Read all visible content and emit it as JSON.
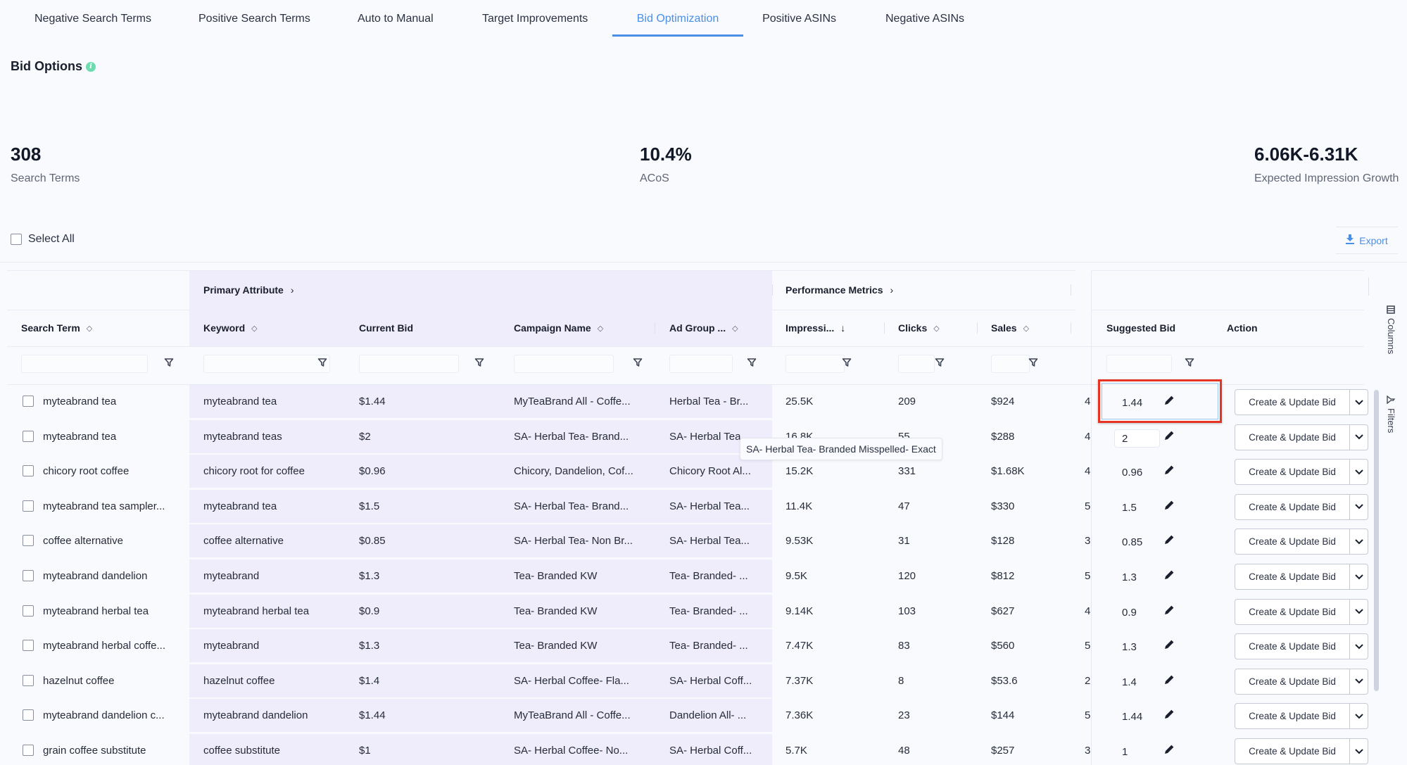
{
  "tabs": [
    {
      "label": "Negative Search Terms",
      "active": false
    },
    {
      "label": "Positive Search Terms",
      "active": false
    },
    {
      "label": "Auto to Manual",
      "active": false
    },
    {
      "label": "Target Improvements",
      "active": false
    },
    {
      "label": "Bid Optimization",
      "active": true
    },
    {
      "label": "Positive ASINs",
      "active": false
    },
    {
      "label": "Negative ASINs",
      "active": false
    }
  ],
  "section": {
    "title": "Bid Options",
    "info_icon": "info-icon"
  },
  "kpis": [
    {
      "value": "308",
      "label": "Search Terms"
    },
    {
      "value": "10.4%",
      "label": "ACoS"
    },
    {
      "value": "6.06K-6.31K",
      "label": "Expected Impression Growth"
    }
  ],
  "select_all_label": "Select All",
  "export_label": "Export",
  "colors": {
    "accent": "#4a8fe7",
    "highlight": "#e53423",
    "group_bg": "#efecfb",
    "info": "#6fdbb0"
  },
  "grid": {
    "groups": {
      "primary": "Primary Attribute",
      "performance": "Performance Metrics"
    },
    "columns": {
      "search_term": "Search Term",
      "keyword": "Keyword",
      "current_bid": "Current Bid",
      "campaign": "Campaign Name",
      "ad_group": "Ad Group ...",
      "impressions": "Impressi...",
      "clicks": "Clicks",
      "sales": "Sales",
      "suggested_bid": "Suggested Bid",
      "action": "Action"
    },
    "sort": {
      "impressions": "descending"
    },
    "action_label": "Create & Update Bid",
    "rows": [
      {
        "search_term": "myteabrand tea",
        "keyword": "myteabrand tea",
        "current_bid": "$1.44",
        "campaign": "MyTeaBrand All - Coffe...",
        "ad_group": "Herbal Tea - Br...",
        "impressions": "25.5K",
        "clicks": "209",
        "sales": "$924",
        "hidden_col": "4",
        "suggested_bid": "1.44"
      },
      {
        "search_term": "myteabrand tea",
        "keyword": "myteabrand teas",
        "current_bid": "$2",
        "campaign": "SA- Herbal Tea- Brand...",
        "ad_group": "SA- Herbal Tea",
        "impressions": "16.8K",
        "clicks": "55",
        "sales": "$288",
        "hidden_col": "4",
        "suggested_bid": "2"
      },
      {
        "search_term": "chicory root coffee",
        "keyword": "chicory root for coffee",
        "current_bid": "$0.96",
        "campaign": "Chicory, Dandelion, Cof...",
        "ad_group": "Chicory Root Al...",
        "impressions": "15.2K",
        "clicks": "331",
        "sales": "$1.68K",
        "hidden_col": "4",
        "suggested_bid": "0.96"
      },
      {
        "search_term": "myteabrand tea sampler...",
        "keyword": "myteabrand tea",
        "current_bid": "$1.5",
        "campaign": "SA- Herbal Tea- Brand...",
        "ad_group": "SA- Herbal Tea...",
        "impressions": "11.4K",
        "clicks": "47",
        "sales": "$330",
        "hidden_col": "5",
        "suggested_bid": "1.5"
      },
      {
        "search_term": "coffee alternative",
        "keyword": "coffee alternative",
        "current_bid": "$0.85",
        "campaign": "SA- Herbal Tea- Non Br...",
        "ad_group": "SA- Herbal Tea...",
        "impressions": "9.53K",
        "clicks": "31",
        "sales": "$128",
        "hidden_col": "3",
        "suggested_bid": "0.85"
      },
      {
        "search_term": "myteabrand dandelion",
        "keyword": "myteabrand",
        "current_bid": "$1.3",
        "campaign": "Tea- Branded KW",
        "ad_group": "Tea- Branded- ...",
        "impressions": "9.5K",
        "clicks": "120",
        "sales": "$812",
        "hidden_col": "5",
        "suggested_bid": "1.3"
      },
      {
        "search_term": "myteabrand herbal tea",
        "keyword": "myteabrand herbal tea",
        "current_bid": "$0.9",
        "campaign": "Tea- Branded KW",
        "ad_group": "Tea- Branded- ...",
        "impressions": "9.14K",
        "clicks": "103",
        "sales": "$627",
        "hidden_col": "4",
        "suggested_bid": "0.9"
      },
      {
        "search_term": "myteabrand herbal coffe...",
        "keyword": "myteabrand",
        "current_bid": "$1.3",
        "campaign": "Tea- Branded KW",
        "ad_group": "Tea- Branded- ...",
        "impressions": "7.47K",
        "clicks": "83",
        "sales": "$560",
        "hidden_col": "5",
        "suggested_bid": "1.3"
      },
      {
        "search_term": "hazelnut coffee",
        "keyword": "hazelnut coffee",
        "current_bid": "$1.4",
        "campaign": "SA- Herbal Coffee- Fla...",
        "ad_group": "SA- Herbal Coff...",
        "impressions": "7.37K",
        "clicks": "8",
        "sales": "$53.6",
        "hidden_col": "2",
        "suggested_bid": "1.4"
      },
      {
        "search_term": "myteabrand dandelion c...",
        "keyword": "myteabrand dandelion",
        "current_bid": "$1.44",
        "campaign": "MyTeaBrand All - Coffe...",
        "ad_group": "Dandelion All- ...",
        "impressions": "7.36K",
        "clicks": "23",
        "sales": "$144",
        "hidden_col": "5",
        "suggested_bid": "1.44"
      },
      {
        "search_term": "grain coffee substitute",
        "keyword": "coffee substitute",
        "current_bid": "$1",
        "campaign": "SA- Herbal Coffee- No...",
        "ad_group": "SA- Herbal Coff...",
        "impressions": "5.7K",
        "clicks": "48",
        "sales": "$257",
        "hidden_col": "3",
        "suggested_bid": "1"
      }
    ]
  },
  "tooltip": "SA- Herbal Tea- Branded Misspelled- Exact",
  "side_panel": {
    "columns_label": "Columns",
    "filters_label": "Filters"
  }
}
